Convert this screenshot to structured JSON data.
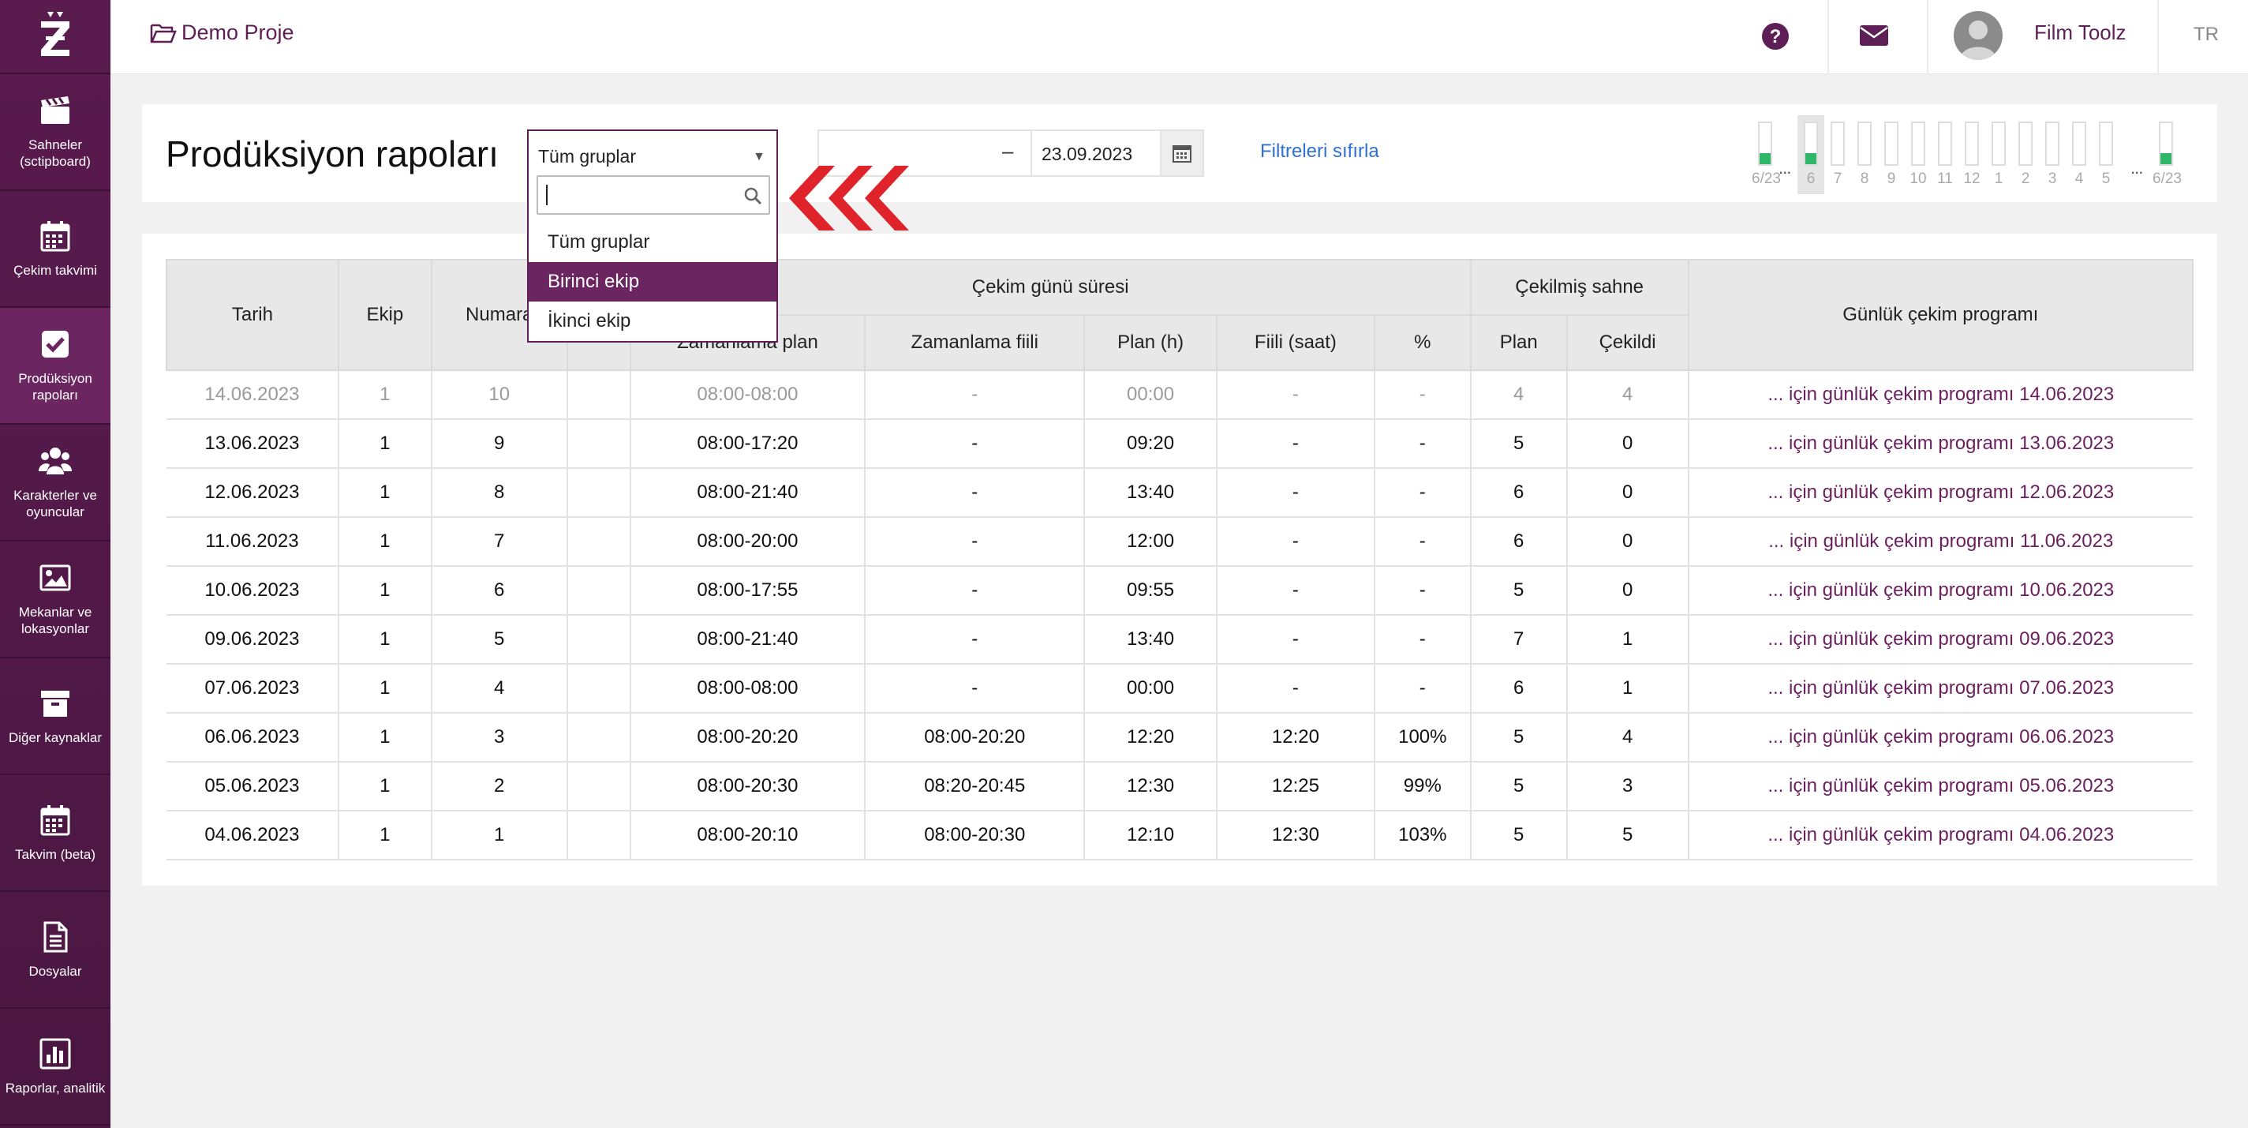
{
  "sidebar": {
    "items": [
      {
        "label": "Sahneler (sctipboard)",
        "icon": "clapperboard-icon"
      },
      {
        "label": "Çekim takvimi",
        "icon": "calendar-icon"
      },
      {
        "label": "Prodüksiyon rapoları",
        "icon": "checkbox-icon"
      },
      {
        "label": "Karakterler ve oyuncular",
        "icon": "users-icon"
      },
      {
        "label": "Mekanlar ve lokasyonlar",
        "icon": "image-icon"
      },
      {
        "label": "Diğer kaynaklar",
        "icon": "archive-icon"
      },
      {
        "label": "Takvim (beta)",
        "icon": "calendar-icon"
      },
      {
        "label": "Dosyalar",
        "icon": "file-icon"
      },
      {
        "label": "Raporlar, analitik",
        "icon": "bar-chart-icon"
      }
    ]
  },
  "topbar": {
    "project": "Demo Proje",
    "user": "Film Toolz",
    "lang": "TR"
  },
  "header": {
    "title": "Prodüksiyon rapoları",
    "group_select": "Tüm gruplar",
    "date_from": "",
    "date_to": "23.09.2023",
    "dash": "–",
    "reset_label": "Filtreleri sıfırla"
  },
  "timeline": {
    "labels": [
      "6/23",
      "6",
      "7",
      "8",
      "9",
      "10",
      "11",
      "12",
      "1",
      "2",
      "3",
      "4",
      "5",
      "6/23"
    ],
    "dots": "...",
    "selected_index": 1
  },
  "dropdown": {
    "search_value": "",
    "options": [
      "Tüm gruplar",
      "Birinci ekip",
      "İkinci ekip"
    ],
    "highlighted": 1
  },
  "table": {
    "headers": {
      "tarih": "Tarih",
      "ekip": "Ekip",
      "numara": "Numara",
      "cekim_gunu": "Çekim günü süresi",
      "cekilmis": "Çekilmiş sahne",
      "program": "Günlük çekim programı",
      "zamanlama_plan": "Zamanlama plan",
      "zamanlama_fiili": "Zamanlama fiili",
      "plan_h": "Plan (h)",
      "fiili_saat": "Fiili (saat)",
      "percent": "%",
      "plan": "Plan",
      "cekildi": "Çekildi"
    },
    "rows": [
      [
        "14.06.2023",
        "1",
        "10",
        "",
        "08:00-08:00",
        "-",
        "00:00",
        "-",
        "-",
        "4",
        "4",
        "... için günlük çekim programı 14.06.2023"
      ],
      [
        "13.06.2023",
        "1",
        "9",
        "",
        "08:00-17:20",
        "-",
        "09:20",
        "-",
        "-",
        "5",
        "0",
        "... için günlük çekim programı 13.06.2023"
      ],
      [
        "12.06.2023",
        "1",
        "8",
        "",
        "08:00-21:40",
        "-",
        "13:40",
        "-",
        "-",
        "6",
        "0",
        "... için günlük çekim programı 12.06.2023"
      ],
      [
        "11.06.2023",
        "1",
        "7",
        "",
        "08:00-20:00",
        "-",
        "12:00",
        "-",
        "-",
        "6",
        "0",
        "... için günlük çekim programı 11.06.2023"
      ],
      [
        "10.06.2023",
        "1",
        "6",
        "",
        "08:00-17:55",
        "-",
        "09:55",
        "-",
        "-",
        "5",
        "0",
        "... için günlük çekim programı 10.06.2023"
      ],
      [
        "09.06.2023",
        "1",
        "5",
        "",
        "08:00-21:40",
        "-",
        "13:40",
        "-",
        "-",
        "7",
        "1",
        "... için günlük çekim programı 09.06.2023"
      ],
      [
        "07.06.2023",
        "1",
        "4",
        "",
        "08:00-08:00",
        "-",
        "00:00",
        "-",
        "-",
        "6",
        "1",
        "... için günlük çekim programı 07.06.2023"
      ],
      [
        "06.06.2023",
        "1",
        "3",
        "",
        "08:00-20:20",
        "08:00-20:20",
        "12:20",
        "12:20",
        "100%",
        "5",
        "4",
        "... için günlük çekim programı 06.06.2023"
      ],
      [
        "05.06.2023",
        "1",
        "2",
        "",
        "08:00-20:30",
        "08:20-20:45",
        "12:30",
        "12:25",
        "99%",
        "5",
        "3",
        "... için günlük çekim programı 05.06.2023"
      ],
      [
        "04.06.2023",
        "1",
        "1",
        "",
        "08:00-20:10",
        "08:00-20:30",
        "12:10",
        "12:30",
        "103%",
        "5",
        "5",
        "... için günlük çekim programı 04.06.2023"
      ]
    ]
  },
  "colors": {
    "brand": "#5d1f55",
    "sidebar": "#4f1946",
    "highlight": "#6b2560",
    "link": "#2f6fd6",
    "green": "#2fb769",
    "arrow": "#e0232b"
  }
}
